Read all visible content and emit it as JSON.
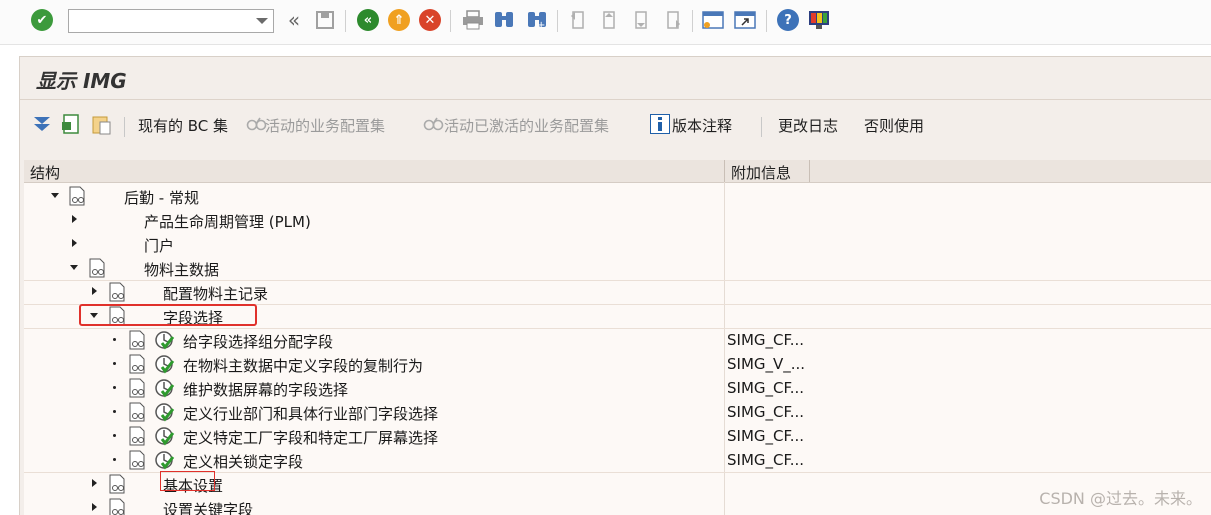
{
  "toolbar": {
    "command_field": {
      "value": "",
      "placeholder": ""
    },
    "icons": [
      "enter-icon",
      "back-icon",
      "exit-icon",
      "cancel-icon",
      "print-icon",
      "find-icon",
      "find-next-icon",
      "first-page-icon",
      "previous-page-icon",
      "next-page-icon",
      "last-page-icon",
      "new-session-icon",
      "shortcut-icon",
      "help-icon",
      "customize-layout-icon"
    ]
  },
  "screen": {
    "title": "显示 IMG"
  },
  "app_toolbar": {
    "existing_bc_sets": "现有的 BC 集",
    "active_bc_sets": "活动的业务配置集",
    "activated_bc_sets": "活动已激活的业务配置集",
    "release_notes": "版本注释",
    "change_log": "更改日志",
    "otherwise_use": "否则使用"
  },
  "tree": {
    "columns": {
      "structure": "结构",
      "additional_info": "附加信息"
    },
    "rows": [
      {
        "label": "后勤 - 常规",
        "info": ""
      },
      {
        "label": "产品生命周期管理 (PLM)",
        "info": ""
      },
      {
        "label": "门户",
        "info": ""
      },
      {
        "label": "物料主数据",
        "info": ""
      },
      {
        "label": "配置物料主记录",
        "info": ""
      },
      {
        "label": "字段选择",
        "info": ""
      },
      {
        "label": "给字段选择组分配字段",
        "info": "SIMG_CF..."
      },
      {
        "label": "在物料主数据中定义字段的复制行为",
        "info": "SIMG_V_..."
      },
      {
        "label": "维护数据屏幕的字段选择",
        "info": "SIMG_CF..."
      },
      {
        "label": "定义行业部门和具体行业部门字段选择",
        "info": "SIMG_CF..."
      },
      {
        "label": "定义特定工厂字段和特定工厂屏幕选择",
        "info": "SIMG_CF..."
      },
      {
        "label": "定义相关锁定字段",
        "info": "SIMG_CF..."
      },
      {
        "label": "基本设置",
        "info": ""
      },
      {
        "label": "设置关键字段",
        "info": ""
      }
    ]
  },
  "colors": {
    "enter": "#3c9a3c",
    "back": "#2d8a2d",
    "exit": "#f0a020",
    "cancel": "#d9442a",
    "highlight": "#e0312b"
  },
  "watermark": "CSDN @过去。未来。"
}
